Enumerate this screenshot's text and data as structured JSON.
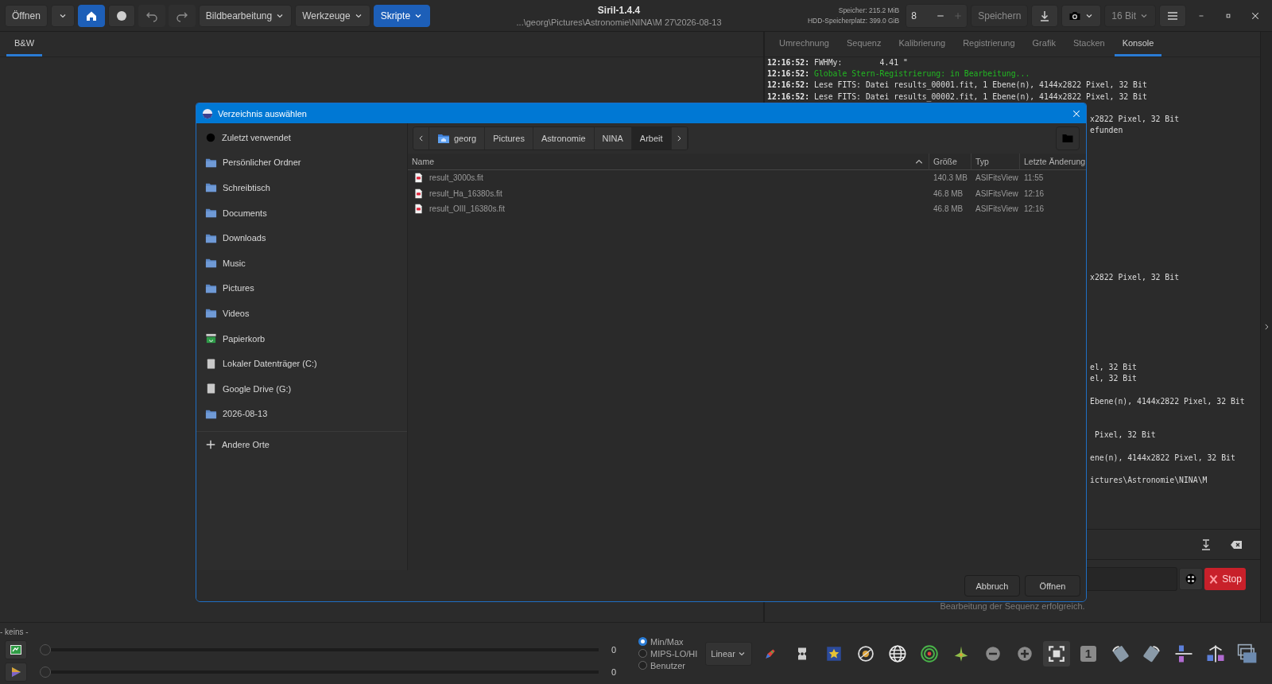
{
  "toolbar": {
    "left": [
      {
        "kind": "text",
        "label": "Öffnen",
        "selected": false,
        "disabled": false
      },
      {
        "kind": "caret",
        "selected": false,
        "disabled": false
      },
      {
        "kind": "home",
        "selected": true,
        "disabled": false
      },
      {
        "kind": "record",
        "selected": false,
        "disabled": false
      },
      {
        "kind": "undo",
        "selected": false,
        "disabled": true
      },
      {
        "kind": "redo",
        "selected": false,
        "disabled": true
      },
      {
        "kind": "menu",
        "label": "Bildbearbeitung",
        "selected": false,
        "disabled": false
      },
      {
        "kind": "menu",
        "label": "Werkzeuge",
        "selected": false,
        "disabled": false
      },
      {
        "kind": "menu",
        "label": "Skripte",
        "selected": true,
        "disabled": false
      }
    ],
    "title": "Siril-1.4.4",
    "path": "...\\georg\\Pictures\\Astronomie\\NINA\\M 27\\2026-08-13",
    "memory": [
      "Speicher: 215.2 MiB",
      "HDD-Speicherplatz: 399.0 GiB"
    ],
    "spin": {
      "value": "8",
      "minus_disabled": false,
      "plus_disabled": true
    },
    "right": [
      {
        "kind": "text",
        "label": "Speichern",
        "disabled": true
      },
      {
        "kind": "save",
        "disabled": false
      },
      {
        "kind": "camera",
        "disabled": false
      },
      {
        "kind": "menu",
        "label": "16 Bit",
        "disabled": true
      },
      {
        "kind": "hamburger",
        "disabled": false
      }
    ]
  },
  "left_tabs": [
    {
      "label": "B&W",
      "selected": true
    }
  ],
  "right_tabs": [
    {
      "label": "Umrechnung",
      "selected": false
    },
    {
      "label": "Sequenz",
      "selected": false
    },
    {
      "label": "Kalibrierung",
      "selected": false
    },
    {
      "label": "Registrierung",
      "selected": false
    },
    {
      "label": "Grafik",
      "selected": false
    },
    {
      "label": "Stacken",
      "selected": false
    },
    {
      "label": "Konsole",
      "selected": true
    }
  ],
  "console": {
    "lines": [
      {
        "kind": "full",
        "time": "12:16:52:",
        "text": "FWHMy:        4.41 \"",
        "color": "#dcdcdc"
      },
      {
        "kind": "full",
        "time": "12:16:52:",
        "text": "Globale Stern-Registrierung: in Bearbeitung...",
        "color": "#22b822"
      },
      {
        "kind": "full",
        "time": "12:16:52:",
        "text": "Lese FITS: Datei results_00001.fit, 1 Ebene(n), 4144x2822 Pixel, 32 Bit",
        "color": "#dcdcdc"
      },
      {
        "kind": "full",
        "time": "12:16:52:",
        "text": "Lese FITS: Datei results_00002.fit, 1 Ebene(n), 4144x2822 Pixel, 32 Bit",
        "color": "#dcdcdc"
      },
      {
        "kind": "covered"
      },
      {
        "kind": "clipped",
        "text": "x2822 Pixel, 32 Bit"
      },
      {
        "kind": "clipped",
        "text": "efunden"
      },
      {
        "kind": "covered"
      },
      {
        "kind": "covered"
      },
      {
        "kind": "covered"
      },
      {
        "kind": "covered"
      },
      {
        "kind": "covered"
      },
      {
        "kind": "covered"
      },
      {
        "kind": "covered"
      },
      {
        "kind": "covered"
      },
      {
        "kind": "covered"
      },
      {
        "kind": "covered"
      },
      {
        "kind": "covered"
      },
      {
        "kind": "covered"
      },
      {
        "kind": "clipped",
        "text": "x2822 Pixel, 32 Bit"
      },
      {
        "kind": "covered"
      },
      {
        "kind": "covered"
      },
      {
        "kind": "covered"
      },
      {
        "kind": "covered"
      },
      {
        "kind": "covered"
      },
      {
        "kind": "covered"
      },
      {
        "kind": "covered"
      },
      {
        "kind": "clipped",
        "text": "el, 32 Bit"
      },
      {
        "kind": "clipped",
        "text": "el, 32 Bit"
      },
      {
        "kind": "covered"
      },
      {
        "kind": "clipped",
        "text": "Ebene(n), 4144x2822 Pixel, 32 Bit"
      },
      {
        "kind": "covered"
      },
      {
        "kind": "covered"
      },
      {
        "kind": "clipped",
        "text": " Pixel, 32 Bit"
      },
      {
        "kind": "covered"
      },
      {
        "kind": "clipped",
        "text": "ene(n), 4144x2822 Pixel, 32 Bit"
      },
      {
        "kind": "covered"
      },
      {
        "kind": "clipped",
        "text": "ictures\\Astronomie\\NINA\\M"
      }
    ],
    "stop_button": "Stop",
    "status": "Bearbeitung der Sequenz erfolgreich."
  },
  "dialog": {
    "title": "Verzeichnis auswählen",
    "places": [
      {
        "kind": "recent",
        "label": "Zuletzt verwendet",
        "selected": false
      },
      {
        "kind": "folder",
        "label": "Persönlicher Ordner",
        "selected": false
      },
      {
        "kind": "folder",
        "label": "Schreibtisch",
        "selected": false
      },
      {
        "kind": "folder",
        "label": "Documents",
        "selected": false
      },
      {
        "kind": "folder",
        "label": "Downloads",
        "selected": false
      },
      {
        "kind": "folder",
        "label": "Music",
        "selected": false
      },
      {
        "kind": "folder",
        "label": "Pictures",
        "selected": false
      },
      {
        "kind": "folder",
        "label": "Videos",
        "selected": false
      },
      {
        "kind": "trash",
        "label": "Papierkorb",
        "selected": false
      },
      {
        "kind": "drive",
        "label": "Lokaler Datenträger (C:)",
        "selected": false
      },
      {
        "kind": "drive",
        "label": "Google Drive (G:)",
        "selected": false
      },
      {
        "kind": "folder",
        "label": "2026-08-13",
        "selected": false
      }
    ],
    "other_places": "Andere Orte",
    "crumbs": [
      {
        "kind": "home",
        "label": "georg",
        "selected": false
      },
      {
        "kind": "plain",
        "label": "Pictures",
        "selected": false
      },
      {
        "kind": "plain",
        "label": "Astronomie",
        "selected": false
      },
      {
        "kind": "plain",
        "label": "NINA",
        "selected": false
      },
      {
        "kind": "plain",
        "label": "Arbeit",
        "selected": true
      }
    ],
    "columns": [
      "Name",
      "Größe",
      "Typ",
      "Letzte Änderung"
    ],
    "files": [
      {
        "name": "result_3000s.fit",
        "size": "140.3 MB",
        "type": "ASIFitsView",
        "modified": "11:55",
        "selected": false
      },
      {
        "name": "result_Ha_16380s.fit",
        "size": "46.8 MB",
        "type": "ASIFitsView",
        "modified": "12:16",
        "selected": false
      },
      {
        "name": "result_OIII_16380s.fit",
        "size": "46.8 MB",
        "type": "ASIFitsView",
        "modified": "12:16",
        "selected": false
      }
    ],
    "buttons": [
      "Abbruch",
      "Öffnen"
    ]
  },
  "bottom": {
    "label": "- keins -",
    "sliders": [
      {
        "kind": "photo",
        "level": 0,
        "value": "0"
      },
      {
        "kind": "colors",
        "level": 0,
        "value": "0"
      }
    ],
    "modes": [
      {
        "label": "Min/Max",
        "selected": true
      },
      {
        "label": "MIPS-LO/HI",
        "selected": false
      },
      {
        "label": "Benutzer",
        "selected": false
      }
    ],
    "scale": "Linear",
    "tools": [
      {
        "kind": "pencil",
        "selected": false
      },
      {
        "kind": "stamp",
        "selected": false
      },
      {
        "kind": "star",
        "selected": false
      },
      {
        "kind": "target",
        "selected": false
      },
      {
        "kind": "globe",
        "selected": false
      },
      {
        "kind": "bullseye",
        "selected": false
      },
      {
        "kind": "sparkle",
        "selected": false
      },
      {
        "kind": "minus",
        "selected": false
      },
      {
        "kind": "plus",
        "selected": false
      },
      {
        "kind": "fit",
        "selected": true
      },
      {
        "kind": "one",
        "label": "1",
        "selected": false
      },
      {
        "kind": "rotate-left",
        "selected": false
      },
      {
        "kind": "rotate-right",
        "selected": false
      },
      {
        "kind": "mirror-x",
        "selected": false
      },
      {
        "kind": "mirror-y",
        "selected": false
      },
      {
        "kind": "stack",
        "selected": false
      }
    ]
  }
}
